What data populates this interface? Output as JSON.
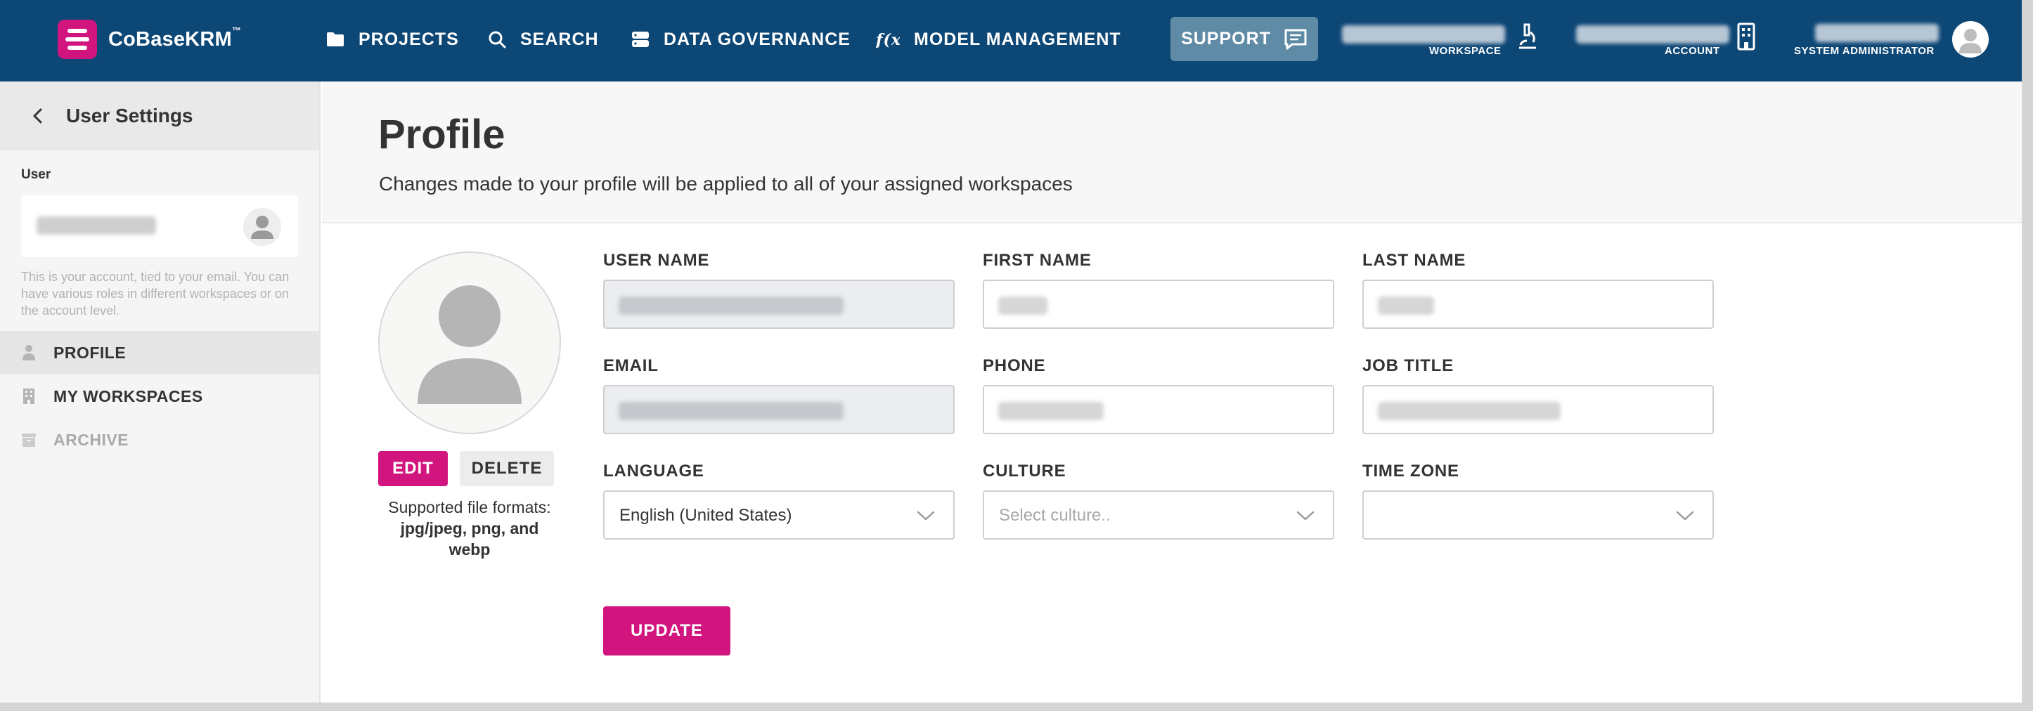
{
  "brand": {
    "name": "CoBaseKRM",
    "trademark": "™"
  },
  "nav": [
    {
      "label": "PROJECTS",
      "icon": "folder-icon"
    },
    {
      "label": "SEARCH",
      "icon": "search-icon"
    },
    {
      "label": "DATA GOVERNANCE",
      "icon": "database-icon"
    },
    {
      "label": "MODEL MANAGEMENT",
      "icon": "function-icon"
    }
  ],
  "support": {
    "label": "SUPPORT",
    "icon": "chat-icon"
  },
  "header": {
    "workspace_caption": "WORKSPACE",
    "account_caption": "ACCOUNT",
    "role_caption": "SYSTEM ADMINISTRATOR"
  },
  "sidebar": {
    "title": "User Settings",
    "user_label": "User",
    "note": "This is your account, tied to your email. You can have various roles in different workspaces or on the account level.",
    "items": [
      {
        "label": "PROFILE",
        "icon": "person-icon",
        "state": "active"
      },
      {
        "label": "MY WORKSPACES",
        "icon": "building-icon",
        "state": "normal"
      },
      {
        "label": "ARCHIVE",
        "icon": "archive-icon",
        "state": "muted"
      }
    ]
  },
  "page": {
    "title": "Profile",
    "subtitle": "Changes made to your profile will be applied to all of your assigned workspaces"
  },
  "avatar": {
    "edit_label": "EDIT",
    "delete_label": "DELETE",
    "formats_line1": "Supported file formats:",
    "formats_line2": "jpg/jpeg, png, and",
    "formats_line3": "webp"
  },
  "form": {
    "username_label": "USER NAME",
    "firstname_label": "FIRST NAME",
    "lastname_label": "LAST NAME",
    "email_label": "EMAIL",
    "phone_label": "PHONE",
    "jobtitle_label": "JOB TITLE",
    "language_label": "LANGUAGE",
    "language_value": "English (United States)",
    "culture_label": "CULTURE",
    "culture_placeholder": "Select culture..",
    "timezone_label": "TIME ZONE",
    "update_label": "UPDATE"
  },
  "colors": {
    "header_bg": "#0d4776",
    "accent": "#d2157e",
    "support_bg": "#5f8ba6"
  }
}
